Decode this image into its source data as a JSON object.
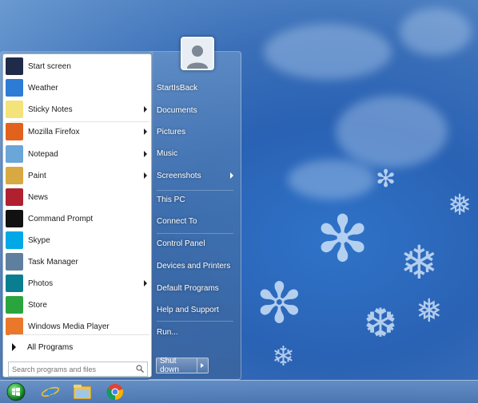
{
  "start_menu": {
    "programs": [
      {
        "label": "Start screen",
        "icon": "start-screen-icon",
        "color": "#1f2b48",
        "has_submenu": false
      },
      {
        "label": "Weather",
        "icon": "weather-icon",
        "color": "#2c7bd4",
        "has_submenu": false
      },
      {
        "label": "Sticky Notes",
        "icon": "sticky-notes-icon",
        "color": "#f3e37a",
        "has_submenu": true
      },
      {
        "label": "Mozilla Firefox",
        "icon": "firefox-icon",
        "color": "#e2611d",
        "has_submenu": true
      },
      {
        "label": "Notepad",
        "icon": "notepad-icon",
        "color": "#6aa6d8",
        "has_submenu": true
      },
      {
        "label": "Paint",
        "icon": "paint-icon",
        "color": "#d8a842",
        "has_submenu": true
      },
      {
        "label": "News",
        "icon": "news-icon",
        "color": "#b0202f",
        "has_submenu": false
      },
      {
        "label": "Command Prompt",
        "icon": "command-prompt-icon",
        "color": "#111111",
        "has_submenu": false
      },
      {
        "label": "Skype",
        "icon": "skype-icon",
        "color": "#00a9e6",
        "has_submenu": false
      },
      {
        "label": "Task Manager",
        "icon": "task-manager-icon",
        "color": "#5f7f9f",
        "has_submenu": false
      },
      {
        "label": "Photos",
        "icon": "photos-icon",
        "color": "#0a7e91",
        "has_submenu": true
      },
      {
        "label": "Store",
        "icon": "store-icon",
        "color": "#2aa53d",
        "has_submenu": false
      },
      {
        "label": "Windows Media Player",
        "icon": "media-player-icon",
        "color": "#e9782b",
        "has_submenu": false
      }
    ],
    "all_programs": "All Programs",
    "search_placeholder": "Search programs and files",
    "right_items": [
      {
        "label": "StartIsBack",
        "has_submenu": false
      },
      {
        "label": "Documents",
        "has_submenu": false
      },
      {
        "label": "Pictures",
        "has_submenu": false
      },
      {
        "label": "Music",
        "has_submenu": false
      },
      {
        "label": "Screenshots",
        "has_submenu": true
      },
      {
        "label": "This PC",
        "has_submenu": false
      },
      {
        "label": "Connect To",
        "has_submenu": false
      },
      {
        "label": "Control Panel",
        "has_submenu": false
      },
      {
        "label": "Devices and Printers",
        "has_submenu": false
      },
      {
        "label": "Default Programs",
        "has_submenu": false
      },
      {
        "label": "Help and Support",
        "has_submenu": false
      },
      {
        "label": "Run...",
        "has_submenu": false
      }
    ],
    "shutdown_label": "Shut down"
  },
  "taskbar": {
    "items": [
      {
        "icon": "start-orb-icon"
      },
      {
        "icon": "internet-explorer-icon"
      },
      {
        "icon": "file-explorer-icon"
      },
      {
        "icon": "chrome-icon"
      }
    ]
  }
}
